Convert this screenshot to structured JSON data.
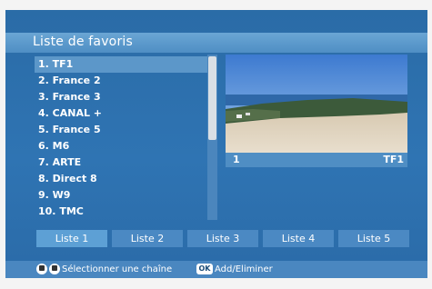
{
  "title": "Liste de favoris",
  "channels": [
    {
      "label": "1. TF1",
      "selected": true
    },
    {
      "label": "2. France 2",
      "selected": false
    },
    {
      "label": "3. France 3",
      "selected": false
    },
    {
      "label": "4. CANAL +",
      "selected": false
    },
    {
      "label": "5. France 5",
      "selected": false
    },
    {
      "label": "6. M6",
      "selected": false
    },
    {
      "label": "7. ARTE",
      "selected": false
    },
    {
      "label": "8. Direct 8",
      "selected": false
    },
    {
      "label": "9. W9",
      "selected": false
    },
    {
      "label": "10. TMC",
      "selected": false
    }
  ],
  "preview": {
    "channel_number": "1",
    "channel_name": "TF1"
  },
  "tabs": [
    {
      "label": "Liste 1",
      "active": true
    },
    {
      "label": "Liste 2",
      "active": false
    },
    {
      "label": "Liste 3",
      "active": false
    },
    {
      "label": "Liste 4",
      "active": false
    },
    {
      "label": "Liste 5",
      "active": false
    }
  ],
  "status": {
    "select_text": "Sélectionner une chaîne",
    "ok_label": "OK",
    "add_remove_text": "Add/Eliminer"
  }
}
